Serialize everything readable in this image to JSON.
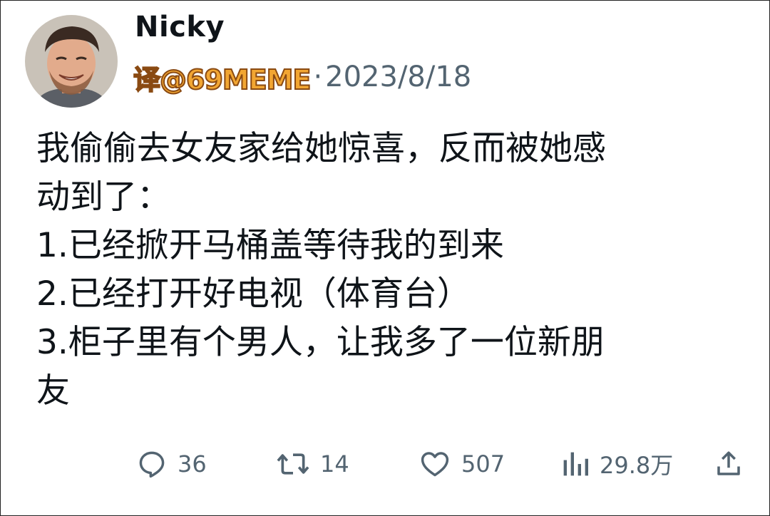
{
  "tweet": {
    "author_name": "Nicky",
    "watermark": "译@69MEME",
    "separator": "·",
    "date": "2023/8/18",
    "text_lines": [
      "我偷偷去女友家给她惊喜，反而被她感",
      "动到了：",
      "1.已经掀开马桶盖等待我的到来",
      "2.已经打开好电视（体育台）",
      "3.柜子里有个男人，让我多了一位新朋",
      "友"
    ]
  },
  "actions": {
    "reply": {
      "icon": "reply-icon",
      "count": "36"
    },
    "retweet": {
      "icon": "retweet-icon",
      "count": "14"
    },
    "like": {
      "icon": "heart-icon",
      "count": "507"
    },
    "views": {
      "icon": "views-icon",
      "count": "29.8万"
    },
    "share": {
      "icon": "share-icon"
    }
  },
  "colors": {
    "text": "#0f1419",
    "muted": "#536471",
    "watermark": "#f2a632"
  }
}
